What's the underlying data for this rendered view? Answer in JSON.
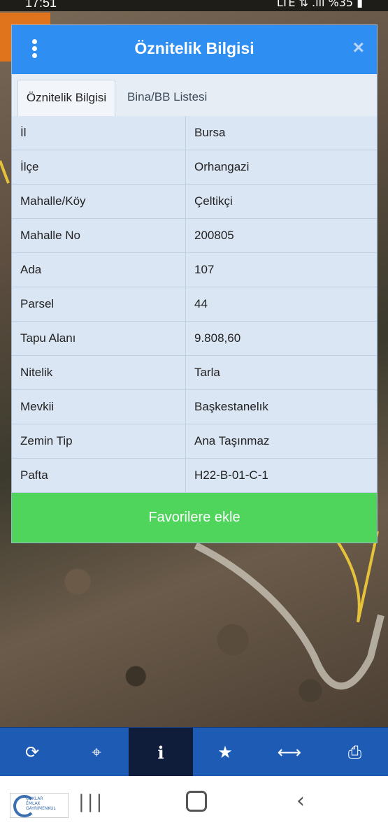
{
  "status": {
    "time": "17:51",
    "right": "LTE ⇅ .ıll %35 ▮"
  },
  "dialog": {
    "title": "Öznitelik Bilgisi",
    "close_icon": "×",
    "tabs": [
      "Öznitelik Bilgisi",
      "Bina/BB Listesi"
    ],
    "rows": [
      {
        "key": "İl",
        "value": "Bursa"
      },
      {
        "key": "İlçe",
        "value": "Orhangazi"
      },
      {
        "key": "Mahalle/Köy",
        "value": "Çeltikçi"
      },
      {
        "key": "Mahalle No",
        "value": "200805"
      },
      {
        "key": "Ada",
        "value": "107"
      },
      {
        "key": "Parsel",
        "value": "44"
      },
      {
        "key": "Tapu Alanı",
        "value": "9.808,60"
      },
      {
        "key": "Nitelik",
        "value": "Tarla"
      },
      {
        "key": "Mevkii",
        "value": "Başkestanelık"
      },
      {
        "key": "Zemin Tip",
        "value": "Ana Taşınmaz"
      },
      {
        "key": "Pafta",
        "value": "H22-B-01-C-1"
      }
    ],
    "favorite_button": "Favorilere ekle"
  },
  "toolbar": {
    "refresh_icon": "⟳",
    "locate_icon": "⌖",
    "info_icon": "i",
    "star_icon": "★",
    "measure_icon": "⟷",
    "print_icon": "⎙"
  },
  "navbar": {
    "recents_icon": "|||",
    "back_icon": "‹"
  },
  "logo": {
    "text": "ÇOKLAR EMLAK GAYRİMENKUL"
  },
  "colors": {
    "header": "#2f8ef2",
    "button": "#4fd45c",
    "toolbar": "#1e5bb5"
  }
}
